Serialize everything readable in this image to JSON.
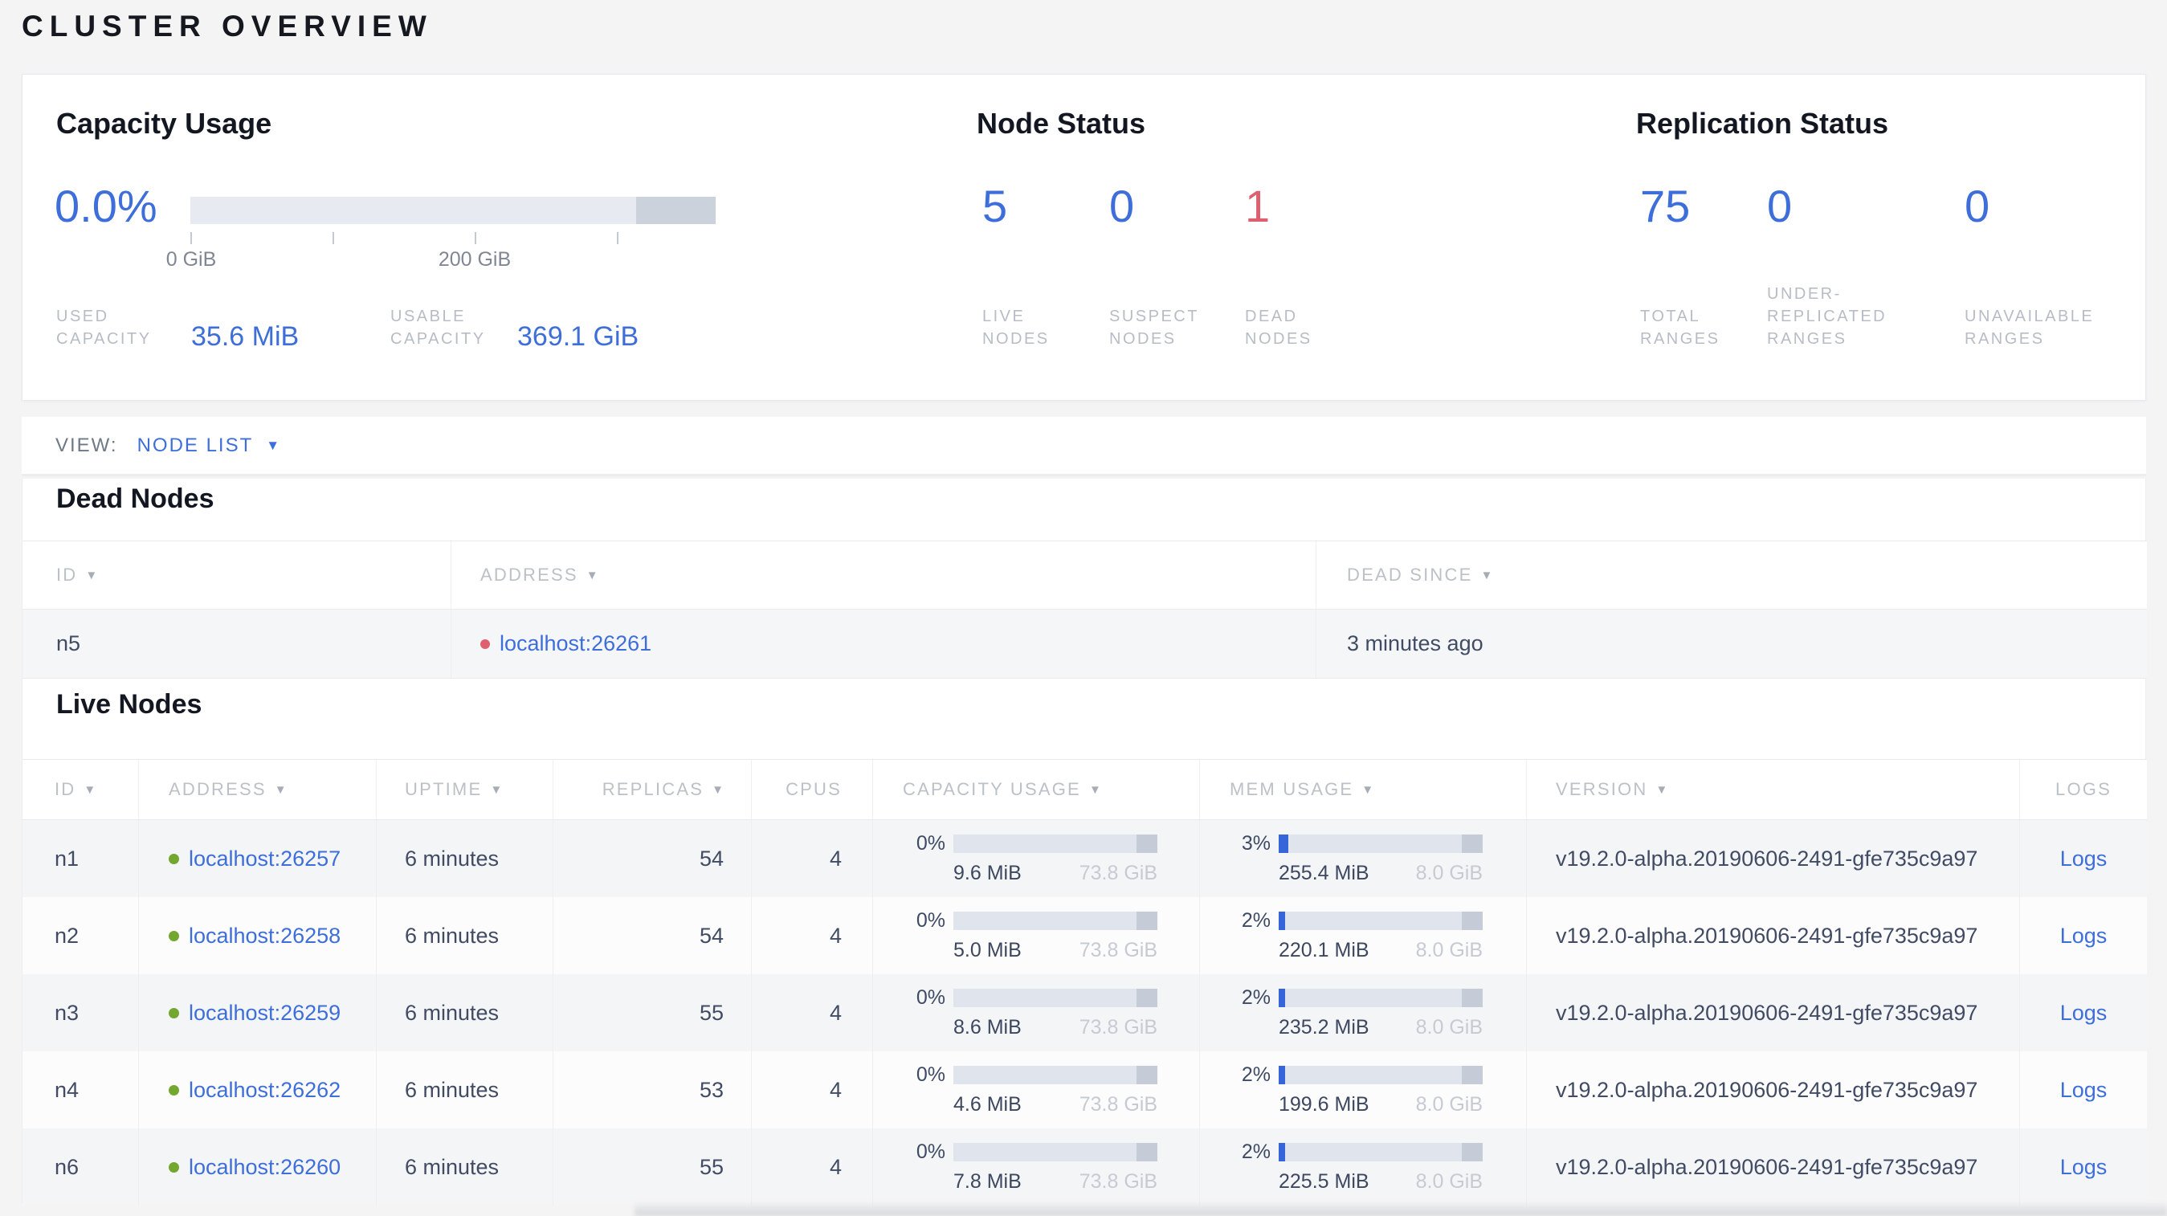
{
  "page": {
    "title": "CLUSTER OVERVIEW"
  },
  "icons": {
    "sort": "▼",
    "caret": "▼"
  },
  "colors": {
    "accent_blue": "#3e6ed9",
    "danger_red": "#de5f6d",
    "live_green": "#74a72f",
    "bar_track": "#e0e4ec",
    "bar_dark": "#c6ccd7",
    "mem_fill": "#3565d9"
  },
  "overview": {
    "capacity": {
      "title": "Capacity Usage",
      "percent": "0.0%",
      "axis_ticks": [
        "0 GiB",
        "200 GiB"
      ],
      "used_label_lines": [
        "USED",
        "CAPACITY"
      ],
      "used_value": "35.6 MiB",
      "usable_label_lines": [
        "USABLE",
        "CAPACITY"
      ],
      "usable_value": "369.1 GiB"
    },
    "node_status": {
      "title": "Node Status",
      "stats": [
        {
          "value": "5",
          "label_lines": [
            "LIVE",
            "NODES"
          ],
          "color": "blue"
        },
        {
          "value": "0",
          "label_lines": [
            "SUSPECT",
            "NODES"
          ],
          "color": "blue"
        },
        {
          "value": "1",
          "label_lines": [
            "DEAD",
            "NODES"
          ],
          "color": "red"
        }
      ]
    },
    "replication": {
      "title": "Replication Status",
      "stats": [
        {
          "value": "75",
          "label_lines": [
            "TOTAL",
            "RANGES"
          ],
          "color": "blue"
        },
        {
          "value": "0",
          "label_lines": [
            "UNDER-",
            "REPLICATED",
            "RANGES"
          ],
          "color": "blue"
        },
        {
          "value": "0",
          "label_lines": [
            "UNAVAILABLE",
            "RANGES"
          ],
          "color": "blue"
        }
      ]
    }
  },
  "view_bar": {
    "label": "VIEW:",
    "selected": "NODE LIST"
  },
  "dead_nodes": {
    "title": "Dead Nodes",
    "columns": [
      {
        "label": "ID",
        "sort": true
      },
      {
        "label": "ADDRESS",
        "sort": true
      },
      {
        "label": "DEAD SINCE",
        "sort": true
      }
    ],
    "rows": [
      {
        "id": "n5",
        "address": "localhost:26261",
        "dead_since": "3 minutes ago"
      }
    ]
  },
  "live_nodes": {
    "title": "Live Nodes",
    "columns": [
      {
        "label": "ID",
        "sort": true
      },
      {
        "label": "ADDRESS",
        "sort": true
      },
      {
        "label": "UPTIME",
        "sort": true
      },
      {
        "label": "REPLICAS",
        "sort": true
      },
      {
        "label": "CPUS",
        "sort": false
      },
      {
        "label": "CAPACITY USAGE",
        "sort": true
      },
      {
        "label": "MEM USAGE",
        "sort": true
      },
      {
        "label": "VERSION",
        "sort": true
      },
      {
        "label": "LOGS",
        "sort": false
      }
    ],
    "rows": [
      {
        "id": "n1",
        "address": "localhost:26257",
        "uptime": "6 minutes",
        "replicas": "54",
        "cpus": "4",
        "capacity": {
          "pct": "0%",
          "fill": 0,
          "used": "9.6 MiB",
          "total": "73.8 GiB"
        },
        "mem": {
          "pct": "3%",
          "fill": 3,
          "used": "255.4 MiB",
          "total": "8.0 GiB"
        },
        "version": "v19.2.0-alpha.20190606-2491-gfe735c9a97",
        "logs": "Logs"
      },
      {
        "id": "n2",
        "address": "localhost:26258",
        "uptime": "6 minutes",
        "replicas": "54",
        "cpus": "4",
        "capacity": {
          "pct": "0%",
          "fill": 0,
          "used": "5.0 MiB",
          "total": "73.8 GiB"
        },
        "mem": {
          "pct": "2%",
          "fill": 2,
          "used": "220.1 MiB",
          "total": "8.0 GiB"
        },
        "version": "v19.2.0-alpha.20190606-2491-gfe735c9a97",
        "logs": "Logs"
      },
      {
        "id": "n3",
        "address": "localhost:26259",
        "uptime": "6 minutes",
        "replicas": "55",
        "cpus": "4",
        "capacity": {
          "pct": "0%",
          "fill": 0,
          "used": "8.6 MiB",
          "total": "73.8 GiB"
        },
        "mem": {
          "pct": "2%",
          "fill": 2,
          "used": "235.2 MiB",
          "total": "8.0 GiB"
        },
        "version": "v19.2.0-alpha.20190606-2491-gfe735c9a97",
        "logs": "Logs"
      },
      {
        "id": "n4",
        "address": "localhost:26262",
        "uptime": "6 minutes",
        "replicas": "53",
        "cpus": "4",
        "capacity": {
          "pct": "0%",
          "fill": 0,
          "used": "4.6 MiB",
          "total": "73.8 GiB"
        },
        "mem": {
          "pct": "2%",
          "fill": 2,
          "used": "199.6 MiB",
          "total": "8.0 GiB"
        },
        "version": "v19.2.0-alpha.20190606-2491-gfe735c9a97",
        "logs": "Logs"
      },
      {
        "id": "n6",
        "address": "localhost:26260",
        "uptime": "6 minutes",
        "replicas": "55",
        "cpus": "4",
        "capacity": {
          "pct": "0%",
          "fill": 0,
          "used": "7.8 MiB",
          "total": "73.8 GiB"
        },
        "mem": {
          "pct": "2%",
          "fill": 2,
          "used": "225.5 MiB",
          "total": "8.0 GiB"
        },
        "version": "v19.2.0-alpha.20190606-2491-gfe735c9a97",
        "logs": "Logs"
      }
    ]
  }
}
